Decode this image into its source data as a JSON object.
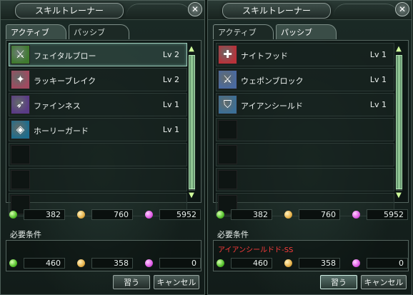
{
  "windows": [
    {
      "title": "スキルトレーナー",
      "close_label": "✕",
      "tabs": [
        "アクティブ",
        "パッシブ"
      ],
      "active_tab": 0,
      "skills": [
        {
          "name": "フェイタルブロー",
          "level": "Lv 2",
          "icon": "fatal-blow-icon",
          "glyph": "⚔",
          "color": "#3f7a2e"
        },
        {
          "name": "ラッキーブレイク",
          "level": "Lv 2",
          "icon": "lucky-break-icon",
          "glyph": "✦",
          "color": "#a04a60"
        },
        {
          "name": "ファインネス",
          "level": "Lv 1",
          "icon": "finesse-icon",
          "glyph": "➶",
          "color": "#5a3b86"
        },
        {
          "name": "ホーリーガード",
          "level": "Lv 1",
          "icon": "holy-guard-icon",
          "glyph": "◈",
          "color": "#1f6c8c"
        }
      ],
      "selected_index": 0,
      "empty_rows": 3,
      "resources": [
        "382",
        "760",
        "5952"
      ],
      "requirements_label": "必要条件",
      "requirement_skill": "",
      "requirements": [
        "460",
        "358",
        "0"
      ],
      "learn_button": "習う",
      "cancel_button": "キャンセル",
      "learn_highlighted": false
    },
    {
      "title": "スキルトレーナー",
      "close_label": "✕",
      "tabs": [
        "アクティブ",
        "パッシブ"
      ],
      "active_tab": 1,
      "skills": [
        {
          "name": "ナイトフッド",
          "level": "Lv 1",
          "icon": "knighthood-icon",
          "glyph": "✚",
          "color": "#b8323a"
        },
        {
          "name": "ウェポンブロック",
          "level": "Lv 1",
          "icon": "weapon-block-icon",
          "glyph": "⚔",
          "color": "#4a6aa0"
        },
        {
          "name": "アイアンシールド",
          "level": "Lv 1",
          "icon": "iron-shield-icon",
          "glyph": "⛉",
          "color": "#3c6f96"
        }
      ],
      "selected_index": -1,
      "empty_rows": 4,
      "resources": [
        "382",
        "760",
        "5952"
      ],
      "requirements_label": "必要条件",
      "requirement_skill": "アイアンシールドド-SS",
      "requirements": [
        "460",
        "358",
        "0"
      ],
      "learn_button": "習う",
      "cancel_button": "キャンセル",
      "learn_highlighted": true
    }
  ],
  "scroll_up_glyph": "▲",
  "scroll_down_glyph": "▼"
}
